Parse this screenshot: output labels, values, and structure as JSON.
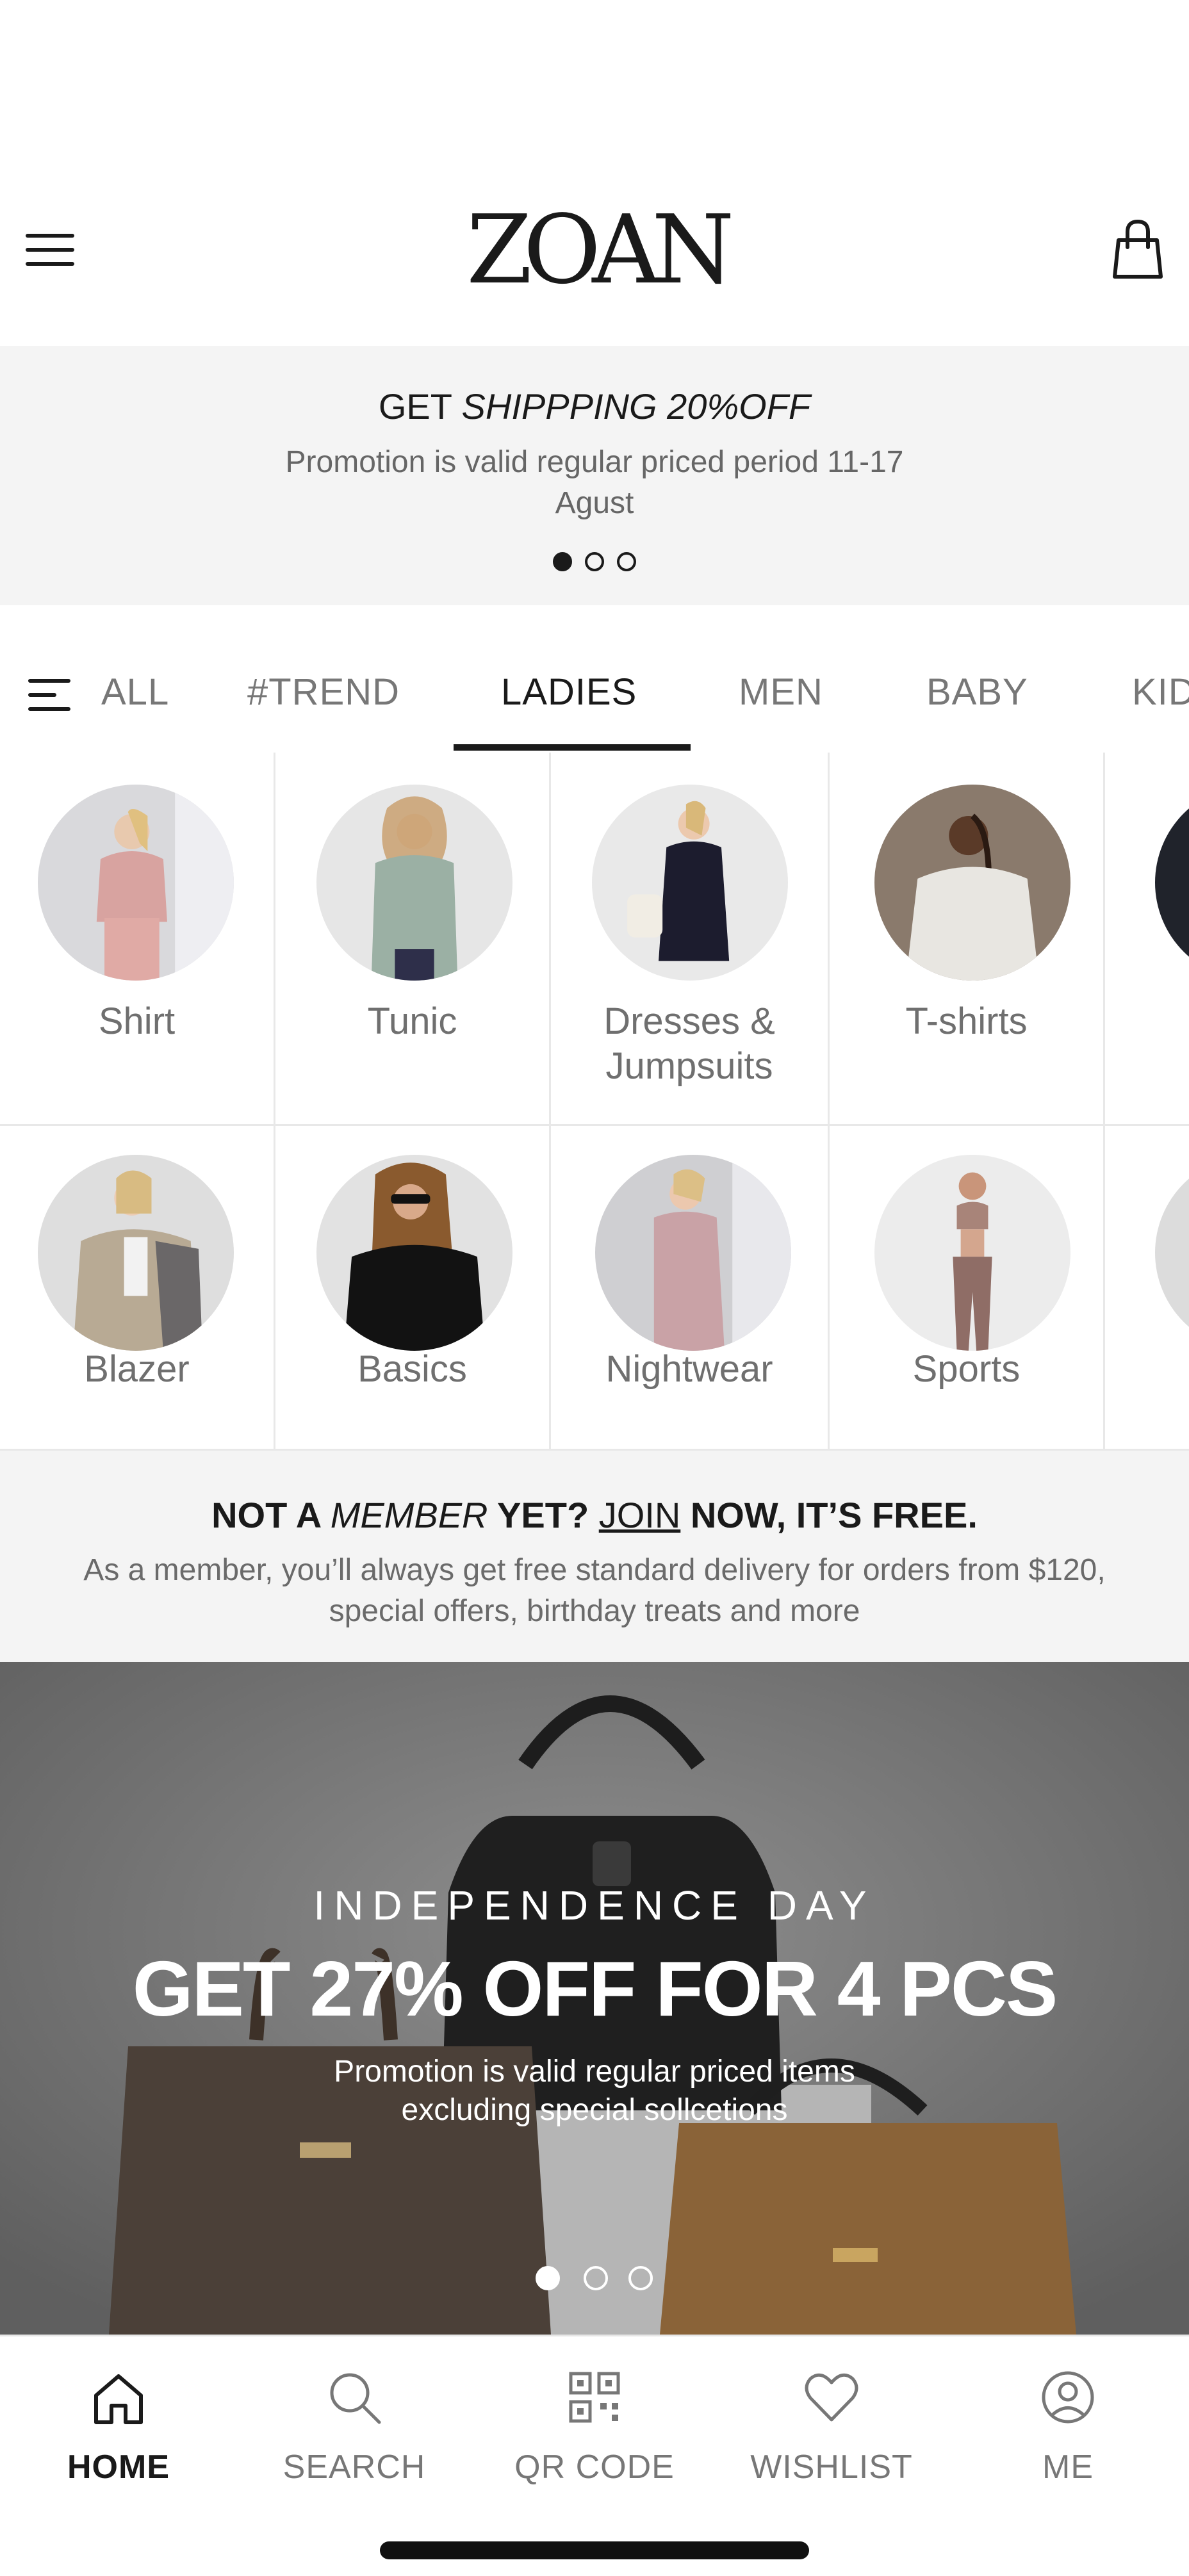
{
  "header": {
    "brand": "ZOAN",
    "menu_icon": "hamburger-menu-icon",
    "cart_icon": "shopping-bag-icon"
  },
  "promo": {
    "title_prefix": "GET ",
    "title_emphasis": "SHIPPPING 20%OFF",
    "subtitle": "Promotion is valid regular priced period 11-17 Agust",
    "slide_count": 3,
    "active_slide": 1
  },
  "tabs": {
    "all_label": "ALL",
    "items": [
      "#TREND",
      "LADIES",
      "MEN",
      "BABY",
      "KIDS"
    ],
    "active": "LADIES"
  },
  "categories": {
    "row1": [
      "Shirt",
      "Tunic",
      "Dresses & Jumpsuits",
      "T-shirts"
    ],
    "row2": [
      "Blazer",
      "Basics",
      "Nightwear",
      "Sports"
    ]
  },
  "member": {
    "part1": "NOT A ",
    "part2": "MEMBER",
    "part3": " YET? ",
    "part4": "JOIN",
    "part5": " NOW, IT’S FREE.",
    "subtitle": "As a member, you’ll always get free standard delivery for orders from $120, special offers, birthday treats and more"
  },
  "hero": {
    "eyebrow": "INDEPENDENCE DAY",
    "title": "GET 27% OFF FOR 4 PCS",
    "subtitle": "Promotion is valid regular priced items excluding special sollcetions",
    "slide_count": 3,
    "active_slide": 1
  },
  "bottom_nav": {
    "home": "HOME",
    "search": "SEARCH",
    "qr": "QR CODE",
    "wishlist": "WISHLIST",
    "me": "ME",
    "active": "HOME"
  },
  "colors": {
    "text": "#1a1a1a",
    "muted": "#777777",
    "banner_bg": "#f4f4f4",
    "hero_bg": "#7a7a7a"
  }
}
